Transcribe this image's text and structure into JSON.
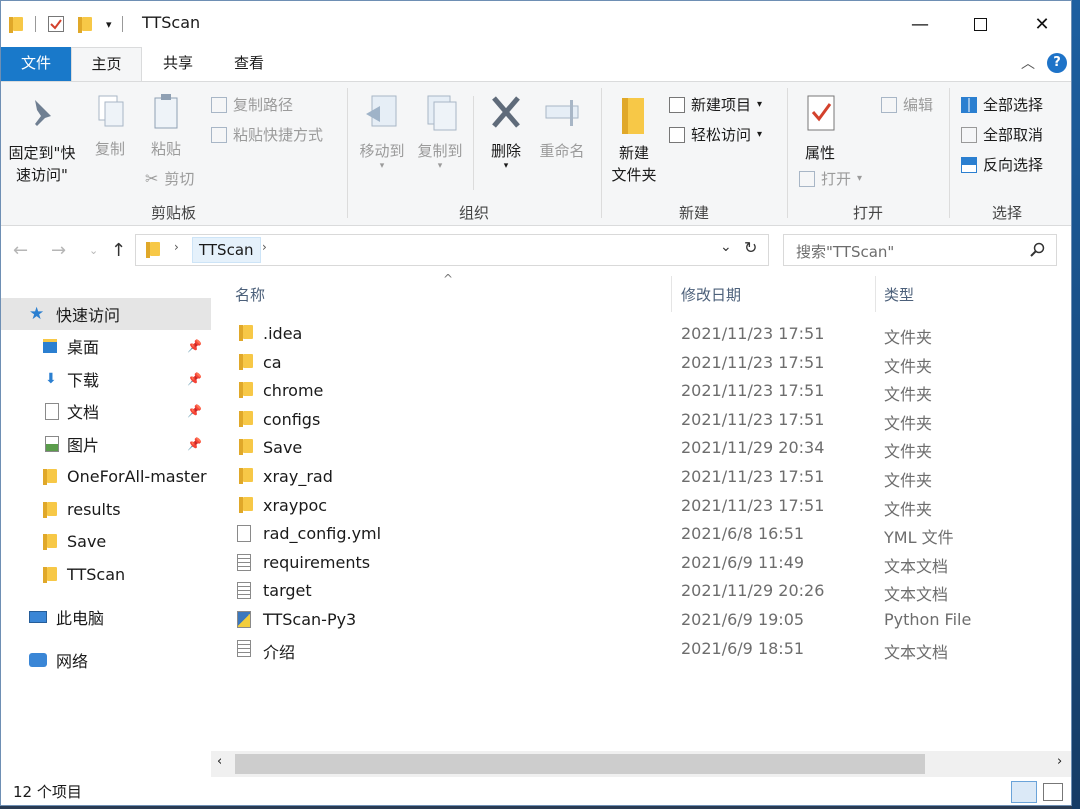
{
  "title": {
    "text": "TTScan"
  },
  "window_controls": {
    "minimize": "—",
    "maximize": "☐",
    "close": "✕"
  },
  "tabs": {
    "file": "文件",
    "home": "主页",
    "share": "共享",
    "view": "查看"
  },
  "ribbon": {
    "clipboard": {
      "pin": "固定到\"快\n速访问\"",
      "copy": "复制",
      "paste": "粘贴",
      "copy_path": "复制路径",
      "paste_shortcut": "粘贴快捷方式",
      "cut": "剪切",
      "label": "剪贴板"
    },
    "organize": {
      "move_to": "移动到",
      "copy_to": "复制到",
      "delete": "删除",
      "rename": "重命名",
      "label": "组织"
    },
    "new": {
      "new_folder": "新建\n文件夹",
      "new_item": "新建项目",
      "easy_access": "轻松访问",
      "label": "新建"
    },
    "open": {
      "properties": "属性",
      "open": "打开",
      "edit": "编辑",
      "label": "打开"
    },
    "select": {
      "select_all": "全部选择",
      "select_none": "全部取消",
      "invert": "反向选择",
      "label": "选择"
    }
  },
  "address": {
    "crumb": "TTScan",
    "search_placeholder": "搜索\"TTScan\""
  },
  "navpane": {
    "quick_access": "快速访问",
    "items": [
      "桌面",
      "下载",
      "文档",
      "图片",
      "OneForAll-master",
      "results",
      "Save",
      "TTScan"
    ],
    "this_pc": "此电脑",
    "network": "网络"
  },
  "columns": {
    "name": "名称",
    "date": "修改日期",
    "type": "类型"
  },
  "files": [
    {
      "name": ".idea",
      "date": "2021/11/23 17:51",
      "type": "文件夹",
      "kind": "folder"
    },
    {
      "name": "ca",
      "date": "2021/11/23 17:51",
      "type": "文件夹",
      "kind": "folder"
    },
    {
      "name": "chrome",
      "date": "2021/11/23 17:51",
      "type": "文件夹",
      "kind": "folder"
    },
    {
      "name": "configs",
      "date": "2021/11/23 17:51",
      "type": "文件夹",
      "kind": "folder"
    },
    {
      "name": "Save",
      "date": "2021/11/29 20:34",
      "type": "文件夹",
      "kind": "folder"
    },
    {
      "name": "xray_rad",
      "date": "2021/11/23 17:51",
      "type": "文件夹",
      "kind": "folder"
    },
    {
      "name": "xraypoc",
      "date": "2021/11/23 17:51",
      "type": "文件夹",
      "kind": "folder"
    },
    {
      "name": "rad_config.yml",
      "date": "2021/6/8 16:51",
      "type": "YML 文件",
      "kind": "doc"
    },
    {
      "name": "requirements",
      "date": "2021/6/9 11:49",
      "type": "文本文档",
      "kind": "txt"
    },
    {
      "name": "target",
      "date": "2021/11/29 20:26",
      "type": "文本文档",
      "kind": "txt"
    },
    {
      "name": "TTScan-Py3",
      "date": "2021/6/9 19:05",
      "type": "Python File",
      "kind": "py"
    },
    {
      "name": "介绍",
      "date": "2021/6/9 18:51",
      "type": "文本文档",
      "kind": "txt"
    }
  ],
  "status": {
    "count": "12 个项目"
  }
}
